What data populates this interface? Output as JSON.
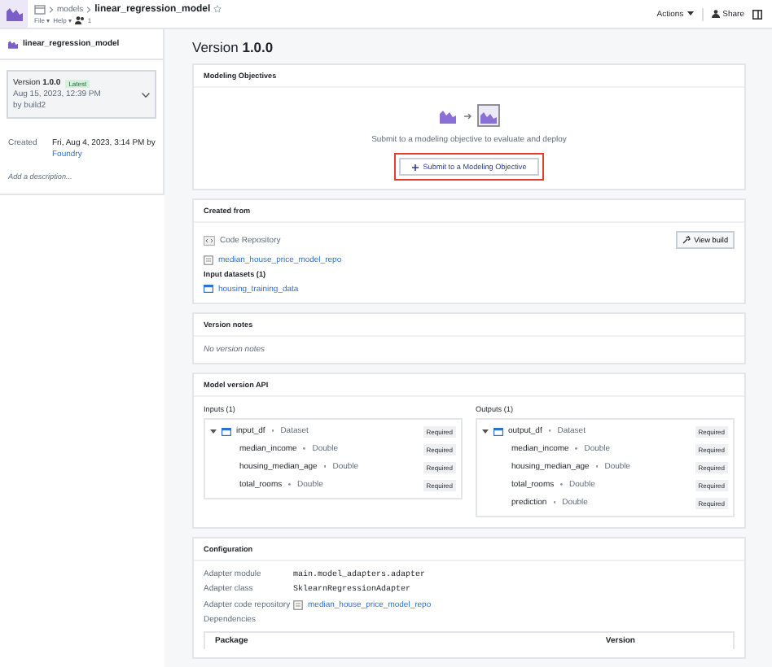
{
  "header": {
    "breadcrumb": [
      "models",
      "linear_regression_model"
    ],
    "menus": [
      "File ▾",
      "Help ▾"
    ],
    "viewer_count": "1",
    "actions": "Actions",
    "share": "Share"
  },
  "sidebar": {
    "title": "linear_regression_model",
    "version_card": {
      "version": "Version **1.0.0**",
      "badge": "Latest",
      "date": "Aug 15, 2023, 12:39 PM",
      "author": "by build2"
    },
    "created_label": "Created",
    "created_value": "Fri, Aug 4, 2023, 3:14 PM by",
    "created_by": "Foundry",
    "description_placeholder": "Add a description..."
  },
  "page_title": "Version **1.0.0**",
  "objectives": {
    "title": "Modeling Objectives",
    "message": "Submit to a modeling objective to evaluate and deploy",
    "button": "Submit to a Modeling Objective",
    "button_highlighted": true
  },
  "created_from": {
    "title": "Created from",
    "source_type": "Code Repository",
    "repository": "median_house_price_model_repo",
    "view_build": "View build",
    "datasets_title": "Input datasets (1)",
    "datasets": [
      "housing_training_data"
    ]
  },
  "version_notes": {
    "title": "Version notes",
    "empty": "No version notes"
  },
  "api": {
    "title": "Model version API",
    "sides": [
      {
        "title": "Inputs (1)",
        "root": {
          "name": "input_df",
          "type": "Dataset",
          "required": "Required",
          "expanded": true,
          "children": [
            {
              "name": "median_income",
              "type": "Double",
              "required": "Required"
            },
            {
              "name": "housing_median_age",
              "type": "Double",
              "required": "Required"
            },
            {
              "name": "total_rooms",
              "type": "Double",
              "required": "Required"
            }
          ]
        }
      },
      {
        "title": "Outputs (1)",
        "root": {
          "name": "output_df",
          "type": "Dataset",
          "required": "Required",
          "expanded": true,
          "children": [
            {
              "name": "median_income",
              "type": "Double",
              "required": "Required"
            },
            {
              "name": "housing_median_age",
              "type": "Double",
              "required": "Required"
            },
            {
              "name": "total_rooms",
              "type": "Double",
              "required": "Required"
            },
            {
              "name": "prediction",
              "type": "Double",
              "required": "Required"
            }
          ]
        }
      }
    ]
  },
  "configuration": {
    "title": "Configuration",
    "rows": [
      {
        "label": "Adapter module",
        "value": "main.model_adapters.adapter",
        "kind": "code"
      },
      {
        "label": "Adapter class",
        "value": "SklearnRegressionAdapter",
        "kind": "code"
      },
      {
        "label": "Adapter code repository",
        "value": "median_house_price_model_repo",
        "kind": "link"
      }
    ],
    "dependencies_label": "Dependencies",
    "table_columns": [
      "Package",
      "Version"
    ]
  }
}
